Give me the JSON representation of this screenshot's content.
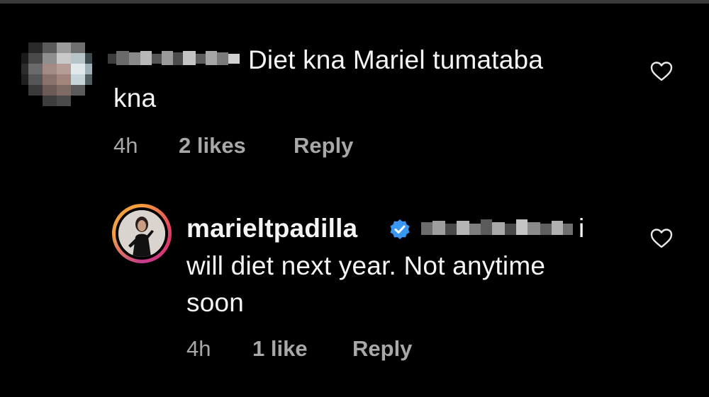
{
  "comment": {
    "text_line1": "Diet kna Mariel tumataba",
    "text_line2": "kna",
    "time": "4h",
    "likes": "2 likes",
    "reply_label": "Reply"
  },
  "reply": {
    "username": "marieltpadilla",
    "text_line1_tail": "i",
    "text_line2": "will diet next year. Not anytime",
    "text_line3": "soon",
    "time": "4h",
    "likes": "1 like",
    "reply_label": "Reply"
  },
  "icons": {
    "like": "heart-outline-icon",
    "verified": "verified-badge-icon"
  },
  "colors": {
    "background": "#000000",
    "text": "#f5f5f5",
    "meta": "#a8a8a8",
    "verified": "#3897f0",
    "story_ring": "#e13a63"
  }
}
